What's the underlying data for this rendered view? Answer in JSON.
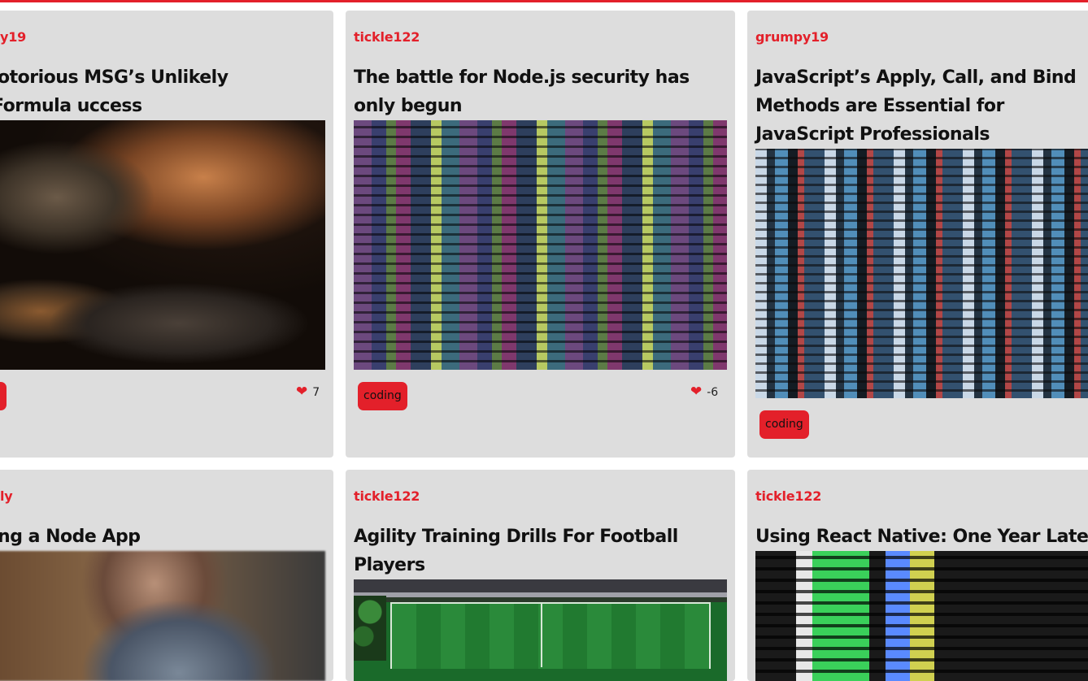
{
  "theme": {
    "accent": "#e3202a",
    "card_bg": "#dddddd",
    "page_bg": "#ffffff"
  },
  "cards": [
    {
      "author": "y19",
      "title": "lotorious MSG’s Unlikely Formula uccess",
      "image": "food-cooking-photo",
      "tag": "g",
      "likes": "7"
    },
    {
      "author": "tickle122",
      "title": "The battle for Node.js security has only begun",
      "image": "colorful-code-screen-photo",
      "tag": "coding",
      "likes": "-6"
    },
    {
      "author": "grumpy19",
      "title": "JavaScript’s Apply, Call, and Bind Methods are Essential for JavaScript Professionals",
      "image": "dark-code-screen-photo",
      "tag": "coding"
    },
    {
      "author": "ly",
      "title": "ing a Node App",
      "image": "blurred-person-photo"
    },
    {
      "author": "tickle122",
      "title": "Agility Training Drills For Football Players",
      "image": "aerial-football-pitch-photo"
    },
    {
      "author": "tickle122",
      "title": "Using React Native: One Year Later",
      "image": "green-code-editor-photo"
    }
  ],
  "icons": {
    "like": "heart-icon"
  }
}
